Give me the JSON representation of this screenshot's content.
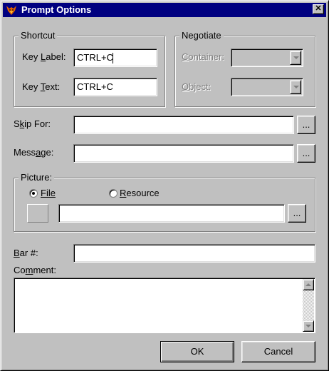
{
  "title": "Prompt Options",
  "icons": {
    "app": "fox-icon",
    "close": "close-icon"
  },
  "shortcut": {
    "legend": "Shortcut",
    "key_label": {
      "label": "Key Label:",
      "value": "CTRL+C"
    },
    "key_text": {
      "label": "Key Text:",
      "value": "CTRL+C"
    }
  },
  "negotiate": {
    "legend": "Negotiate",
    "container_label": "Container:",
    "object_label": "Object:",
    "container_value": "",
    "object_value": ""
  },
  "skip_for": {
    "label": "Skip For:",
    "value": "",
    "browse": "..."
  },
  "message": {
    "label": "Message:",
    "value": "",
    "browse": "..."
  },
  "picture": {
    "legend": "Picture:",
    "file_option": "File",
    "resource_option": "Resource",
    "selected": "File",
    "path_value": "",
    "browse": "..."
  },
  "bar_number": {
    "label": "Bar #:",
    "value": ""
  },
  "comment": {
    "label": "Comment:",
    "value": ""
  },
  "buttons": {
    "ok": "OK",
    "cancel": "Cancel"
  },
  "colors": {
    "titlebar": "#000080",
    "face": "#c0c0c0",
    "disabled_text": "#808080"
  }
}
